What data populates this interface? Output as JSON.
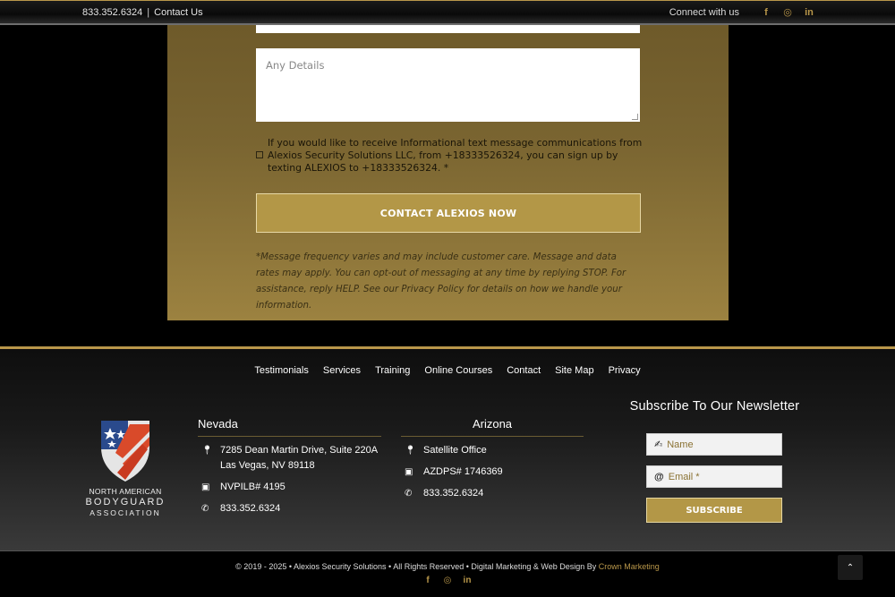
{
  "topbar": {
    "phone": "833.352.6324",
    "separator": "|",
    "contact_link": "Contact Us",
    "connect_label": "Connect with us",
    "social": [
      "f",
      "◎",
      "in"
    ]
  },
  "form": {
    "details_placeholder": "Any Details",
    "consent_text": "If you would like to receive Informational text message communications from Alexios Security Solutions LLC, from +18333526324, you can sign up by texting ALEXIOS to +18333526324. *",
    "submit_label": "CONTACT ALEXIOS NOW",
    "disclaimer": "*Message frequency varies and may include customer care. Message and data rates may apply. You can opt-out of messaging at any time by replying STOP. For assistance, reply HELP. See our Privacy Policy for details on how we handle your information."
  },
  "footer_nav": [
    "Testimonials",
    "Services",
    "Training",
    "Online Courses",
    "Contact",
    "Site Map",
    "Privacy"
  ],
  "logo": {
    "line1": "NORTH AMERICAN",
    "line2": "BODYGUARD",
    "line3": "ASSOCIATION"
  },
  "nevada": {
    "title": "Nevada",
    "address1": "7285 Dean Martin Drive, Suite 220A",
    "address2": "Las Vegas, NV 89118",
    "license": "NVPILB# 4195",
    "phone": "833.352.6324"
  },
  "arizona": {
    "title": "Arizona",
    "office": "Satellite Office",
    "license": "AZDPS# 1746369",
    "phone": "833.352.6324"
  },
  "newsletter": {
    "title": "Subscribe To Our Newsletter",
    "name_placeholder": "Name",
    "email_placeholder": "Email *",
    "button": "SUBSCRIBE"
  },
  "bottom": {
    "copyright": "© 2019 - 2025 • Alexios Security Solutions • All Rights Reserved • Digital Marketing & Web Design By ",
    "credit": "Crown Marketing",
    "social": [
      "f",
      "◎",
      "in"
    ],
    "to_top": "⌃"
  },
  "colors": {
    "gold": "#b9974a",
    "button_gold": "#b39747"
  }
}
